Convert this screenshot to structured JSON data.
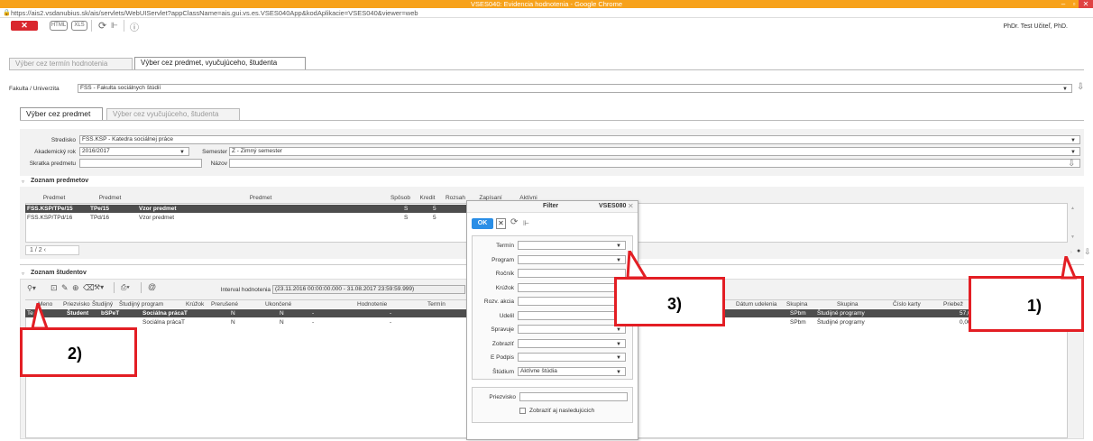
{
  "window": {
    "title": "VSES040: Evidencia hodnotenia - Google Chrome",
    "url": "https://ais2.vsdanubius.sk/ais/servlets/WebUIServlet?appClassName=ais.gui.vs.es.VSES040App&kodAplikacie=VSES040&viewer=web"
  },
  "toolbar": {
    "close_label": "✕",
    "html_label": "HTML",
    "xls_label": "XLS",
    "user": "PhDr. Test Učiteľ, PhD."
  },
  "main_tabs": [
    "Výber cez termín hodnotenia",
    "Výber cez predmet, vyučujúceho, študenta"
  ],
  "faculty": {
    "label": "Fakulta / Univerzita",
    "value": "FSS - Fakulta sociálnych štúdií"
  },
  "sub_tabs": [
    "Výber cez predmet",
    "Výber cez vyučujúceho, študenta"
  ],
  "form": {
    "stredisko_label": "Stredisko",
    "stredisko_value": "FSS.KSP - Katedra sociálnej práce",
    "rok_label": "Akademický rok",
    "rok_value": "2016/2017",
    "semester_label": "Semester",
    "semester_value": "Z - Zimný semester",
    "skratka_label": "Skratka predmetu",
    "skratka_value": "",
    "nazov_label": "Názov",
    "nazov_value": ""
  },
  "predmety": {
    "title": "Zoznam predmetov",
    "headers": [
      "Predmet",
      "Predmet",
      "Predmet",
      "Spôsob",
      "Kredit",
      "Rozsah",
      "Zapísaní",
      "Aktívni"
    ],
    "rows": [
      [
        "FSS.KSP/TPe/15",
        "TPe/15",
        "Vzor predmet",
        "S",
        "5"
      ],
      [
        "FSS.KSP/TPd/16",
        "TPd/16",
        "Vzor predmet",
        "S",
        "5"
      ]
    ],
    "pager": "1   /   2   ‹"
  },
  "studenti": {
    "title": "Zoznam študentov",
    "interval_label": "Interval hodnotenia",
    "interval_value": "(23.11.2016 00:00:00.000 - 31.08.2017 23:59:59.999)",
    "headers": [
      "Meno",
      "Priezvisko",
      "Študijný",
      "Študijný program",
      "Krúžok",
      "Prerušené",
      "Ukončené",
      "Hodnotenie",
      "Termín"
    ],
    "headers_right": [
      "Dátum udelenia",
      "Skupina",
      "Skupina",
      "Číslo karty",
      "Priebež"
    ],
    "rows": [
      {
        "meno": "Te",
        "priezvisko": "Študent",
        "studijny": "bSPeT",
        "program": "Sociálna prácaT",
        "prerusene": "N",
        "ukoncene": "N",
        "hodnotenie": "-",
        "termin": "-",
        "skupina": "SPbm",
        "skupina2": "Študijné programy",
        "priebez": "57,00"
      },
      {
        "meno": "",
        "priezvisko": "",
        "studijny": "",
        "program": "Sociálna prácaT",
        "prerusene": "N",
        "ukoncene": "N",
        "hodnotenie": "-",
        "termin": "-",
        "skupina": "SPbm",
        "skupina2": "Študijné programy",
        "priebez": "0,00"
      }
    ]
  },
  "filter": {
    "title": "Filter",
    "code": "VSES080",
    "ok_label": "OK",
    "fields": [
      {
        "label": "Termín",
        "value": "",
        "type": "select"
      },
      {
        "label": "Program",
        "value": "",
        "type": "select"
      },
      {
        "label": "Ročník",
        "value": "",
        "type": "text"
      },
      {
        "label": "Krúžok",
        "value": "",
        "type": "text"
      },
      {
        "label": "Rozv. akcia",
        "value": "",
        "type": "text"
      },
      {
        "label": "Udelil",
        "value": "",
        "type": "text"
      },
      {
        "label": "Spravuje",
        "value": "",
        "type": "select"
      },
      {
        "label": "Zobraziť",
        "value": "",
        "type": "select"
      },
      {
        "label": "E Podpis",
        "value": "",
        "type": "select"
      },
      {
        "label": "Štúdium",
        "value": "Aktívne štúdia",
        "type": "select"
      }
    ],
    "priezvisko_label": "Priezvisko",
    "checkbox_label": "Zobraziť aj nasledujúcich"
  },
  "callouts": [
    "1)",
    "2)",
    "3)"
  ],
  "colors": {
    "titlebar": "#f7a21b",
    "accent": "#2a8ee6",
    "callout": "#e31e24",
    "selected_row": "#4d4d4d"
  }
}
